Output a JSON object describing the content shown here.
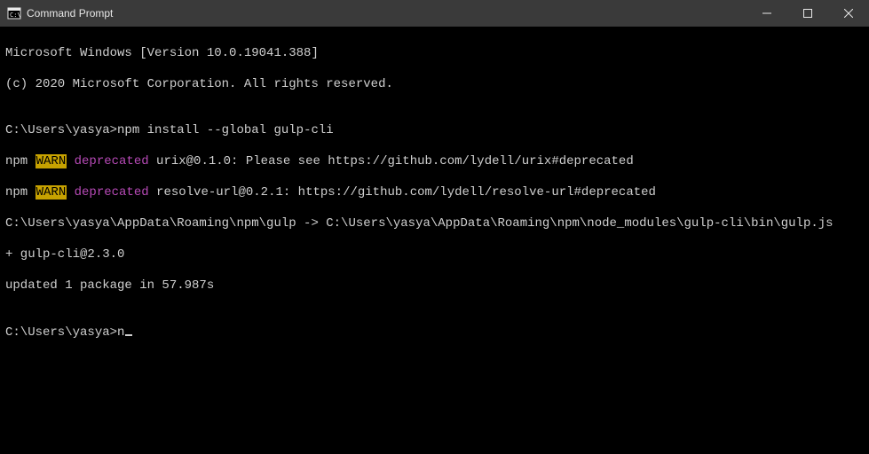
{
  "window": {
    "title": "Command Prompt"
  },
  "terminal": {
    "banner_line1": "Microsoft Windows [Version 10.0.19041.388]",
    "banner_line2": "(c) 2020 Microsoft Corporation. All rights reserved.",
    "blank": "",
    "prompt1_path": "C:\\Users\\yasya>",
    "prompt1_cmd": "npm install --global gulp-cli",
    "warn1_prefix": "npm ",
    "warn1_tag": "WARN",
    "warn1_sp": " ",
    "warn1_deprecated": "deprecated",
    "warn1_rest": " urix@0.1.0: Please see https://github.com/lydell/urix#deprecated",
    "warn2_prefix": "npm ",
    "warn2_tag": "WARN",
    "warn2_sp": " ",
    "warn2_deprecated": "deprecated",
    "warn2_rest": " resolve-url@0.2.1: https://github.com/lydell/resolve-url#deprecated",
    "link_line": "C:\\Users\\yasya\\AppData\\Roaming\\npm\\gulp -> C:\\Users\\yasya\\AppData\\Roaming\\npm\\node_modules\\gulp-cli\\bin\\gulp.js",
    "pkg_line": "+ gulp-cli@2.3.0",
    "updated_line": "updated 1 package in 57.987s",
    "prompt2_path": "C:\\Users\\yasya>",
    "prompt2_typed": "n"
  }
}
